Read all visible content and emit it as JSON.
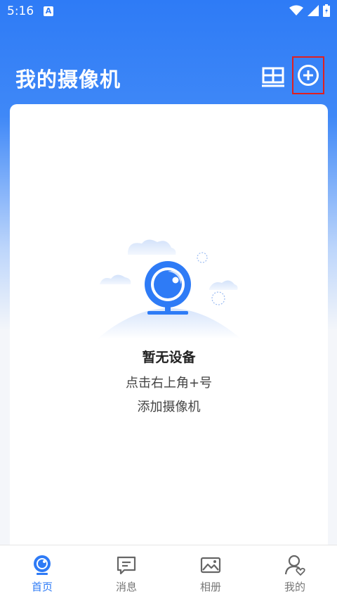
{
  "status_bar": {
    "time": "5:16",
    "notification_icon_letter": "A",
    "icons": [
      "wifi-icon",
      "signal-icon",
      "battery-icon"
    ]
  },
  "header": {
    "title": "我的摄像机",
    "actions": [
      "layout-grid-icon",
      "add-circle-icon"
    ]
  },
  "empty_state": {
    "title": "暂无设备",
    "line1": "点击右上角+号",
    "line2": "添加摄像机"
  },
  "bottom_nav": {
    "items": [
      {
        "label": "首页",
        "icon": "camera-home-icon",
        "active": true
      },
      {
        "label": "消息",
        "icon": "message-icon",
        "active": false
      },
      {
        "label": "相册",
        "icon": "album-icon",
        "active": false
      },
      {
        "label": "我的",
        "icon": "profile-icon",
        "active": false
      }
    ]
  },
  "colors": {
    "primary": "#2e7bf6",
    "highlight_box": "#e02020",
    "background": "#f4f6fa"
  }
}
